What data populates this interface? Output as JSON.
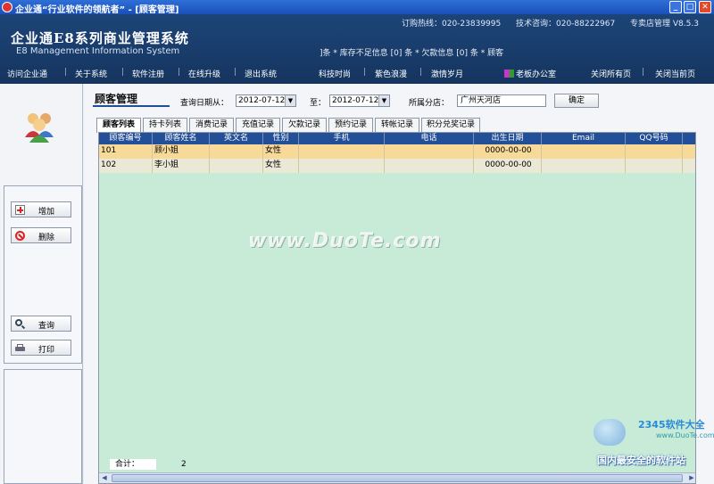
{
  "window": {
    "title": "企业通“行业软件的领航者”  -  [顾客管理]",
    "min": "_",
    "max": "□",
    "close": "✕"
  },
  "header": {
    "hotline": "订购热线：020-23839995",
    "support": "技术咨询：020-88222967",
    "edition": "专卖店管理 V8.5.3",
    "app_title": "企业通E8系列商业管理系统",
    "app_subtitle": "E8 Management Information System",
    "notices": "]条 * 库存不足信息 [0] 条 * 欠款信息 [0] 条 * 顾客",
    "nav_left": [
      "访问企业通",
      "关于系统",
      "软件注册",
      "在线升级",
      "退出系统"
    ],
    "nav_right": [
      "科技时尚",
      "紫色浪漫",
      "激情岁月",
      "老板办公室",
      "关闭所有页",
      "关闭当前页"
    ]
  },
  "left": {
    "buttons": {
      "add": "增加",
      "delete": "删除",
      "query": "查询",
      "print": "打印"
    }
  },
  "main": {
    "section_title": "顾客管理",
    "date_from_label": "查询日期从：",
    "date_from": "2012-07-12",
    "date_to_label": "至：",
    "date_to": "2012-07-12",
    "store_label": "所属分店：",
    "store": "广州天河店",
    "ok": "确定",
    "tabs": [
      "顾客列表",
      "持卡列表",
      "消费记录",
      "充值记录",
      "欠款记录",
      "预约记录",
      "转帐记录",
      "积分兑奖记录"
    ],
    "columns": [
      "顾客编号",
      "顾客姓名",
      "英文名",
      "性别",
      "手机",
      "电话",
      "出生日期",
      "Email",
      "QQ号码"
    ],
    "rows": [
      [
        "101",
        "顾小姐",
        "",
        "女性",
        "",
        "",
        "0000-00-00",
        "",
        ""
      ],
      [
        "102",
        "李小姐",
        "",
        "女性",
        "",
        "",
        "0000-00-00",
        "",
        ""
      ]
    ],
    "total_label": "合计：",
    "total_value": "2",
    "scroll_left": "◀",
    "scroll_right": "▶"
  },
  "watermarks": {
    "duote": "www.DuoTe.com",
    "logo": "2345软件大全",
    "site": "www.DuoTe.com",
    "slogan": "国内最安全的软件站"
  },
  "colors": {
    "titlebar": "#1a4fb8",
    "header": "#1d4478",
    "grid_header": "#224f97",
    "grid_bg": "#c7ebd6",
    "row_selected": "#f7d99a"
  }
}
